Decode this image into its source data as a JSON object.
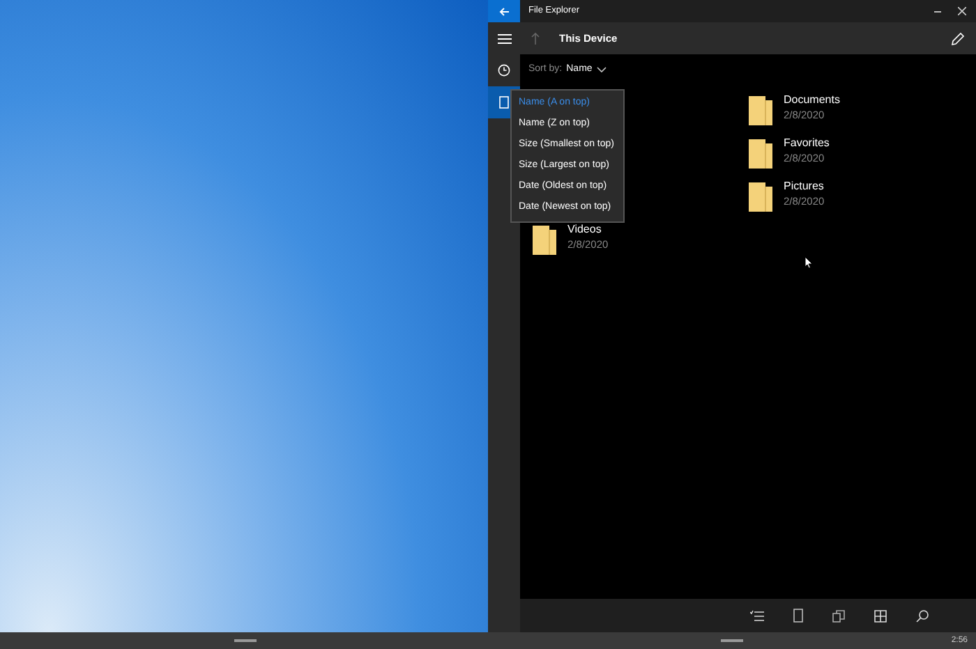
{
  "window": {
    "title": "File Explorer"
  },
  "header": {
    "title": "This Device"
  },
  "sort": {
    "label": "Sort by:",
    "value": "Name"
  },
  "files": [
    {
      "name": "Documents",
      "date": "2/8/2020"
    },
    {
      "name": "Favorites",
      "date": "2/8/2020"
    },
    {
      "name": "Pictures",
      "date": "2/8/2020"
    },
    {
      "name": "Videos",
      "date": "2/8/2020"
    }
  ],
  "sort_menu": [
    {
      "label": "Name (A on top)",
      "selected": true
    },
    {
      "label": "Name (Z on top)",
      "selected": false
    },
    {
      "label": "Size (Smallest on top)",
      "selected": false
    },
    {
      "label": "Size (Largest on top)",
      "selected": false
    },
    {
      "label": "Date (Oldest on top)",
      "selected": false
    },
    {
      "label": "Date (Newest on top)",
      "selected": false
    }
  ],
  "nav": [
    {
      "kind": "recent",
      "selected": false
    },
    {
      "kind": "device",
      "selected": true
    }
  ],
  "clock": "2:56"
}
